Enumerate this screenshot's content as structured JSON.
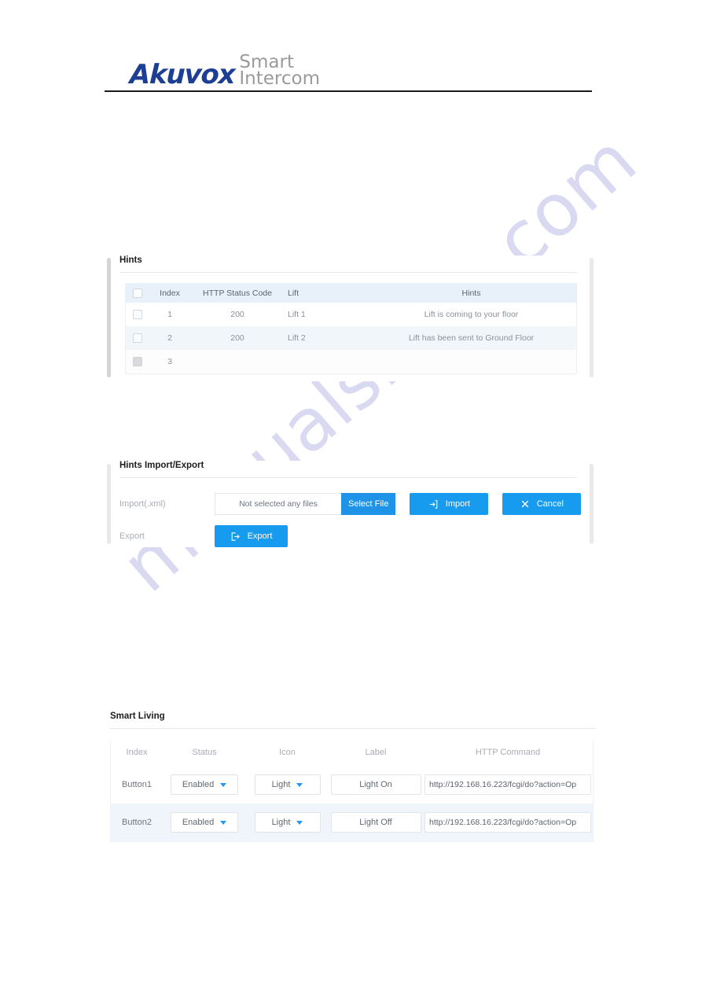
{
  "brand": {
    "name": "Akuvox",
    "tagline_line1": "Smart",
    "tagline_line2": "Intercom",
    "logo_color": "#1c3f94",
    "tagline_color": "#9a9a9a"
  },
  "watermark": {
    "text": "manualshive.com",
    "color": "#d9d8f2"
  },
  "theme": {
    "accent": "#169bef",
    "accent_alt": "#1f93e8",
    "caret": "#2196f3",
    "table_header_bg": "#e8f0f9",
    "row_alt_bg": "#f1f6fb"
  },
  "hints_panel": {
    "title": "Hints",
    "columns": [
      "",
      "Index",
      "HTTP Status Code",
      "Lift",
      "Hints"
    ],
    "rows": [
      {
        "checkbox": "unchecked",
        "index": "1",
        "status_code": "200",
        "lift": "Lift 1",
        "hint": "Lift is coming to your floor"
      },
      {
        "checkbox": "unchecked",
        "index": "2",
        "status_code": "200",
        "lift": "Lift 2",
        "hint": "Lift has been sent to Ground Floor"
      },
      {
        "checkbox": "filled",
        "index": "3",
        "status_code": "",
        "lift": "",
        "hint": ""
      }
    ]
  },
  "import_export_panel": {
    "title": "Hints Import/Export",
    "import_label": "Import(.xml)",
    "export_label": "Export",
    "file_placeholder": "Not selected any files",
    "select_file_label": "Select File",
    "import_button_label": "Import",
    "cancel_button_label": "Cancel",
    "export_button_label": "Export"
  },
  "smart_living_panel": {
    "title": "Smart Living",
    "columns": [
      "Index",
      "Status",
      "Icon",
      "Label",
      "HTTP Command"
    ],
    "rows": [
      {
        "index": "Button1",
        "status": "Enabled",
        "icon": "Light",
        "label": "Light On",
        "command": "http://192.168.16.223/fcgi/do?action=Op"
      },
      {
        "index": "Button2",
        "status": "Enabled",
        "icon": "Light",
        "label": "Light Off",
        "command": "http://192.168.16.223/fcgi/do?action=Op"
      }
    ]
  }
}
